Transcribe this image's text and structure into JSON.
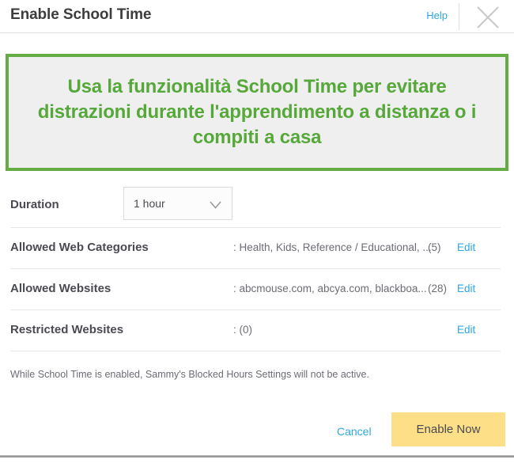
{
  "header": {
    "title": "Enable School Time",
    "help_label": "Help",
    "close_icon": "close-icon"
  },
  "banner": {
    "message": "Usa la funzionalità School Time per evitare distrazioni durante l'apprendimento a distanza o i compiti a casa",
    "border_color": "#66ac45",
    "text_color": "#57a83a",
    "background_color": "#efefef"
  },
  "duration": {
    "label": "Duration",
    "selected": "1 hour",
    "chevron_icon": "chevron-down-icon"
  },
  "settings": [
    {
      "label": "Allowed Web Categories",
      "value": ": Health, Kids, Reference / Educational, ...",
      "count": "(5)",
      "edit_label": "Edit"
    },
    {
      "label": "Allowed Websites",
      "value": ": abcmouse.com, abcya.com, blackboa...",
      "count": "(28)",
      "edit_label": "Edit"
    },
    {
      "label": "Restricted Websites",
      "value": ": (0)",
      "count": "",
      "edit_label": "Edit"
    }
  ],
  "note": "While School Time is enabled, Sammy's Blocked Hours Settings will not be active.",
  "actions": {
    "cancel_label": "Cancel",
    "enable_label": "Enable Now",
    "enable_color": "#fcdf87",
    "link_color": "#2ea7e0"
  }
}
